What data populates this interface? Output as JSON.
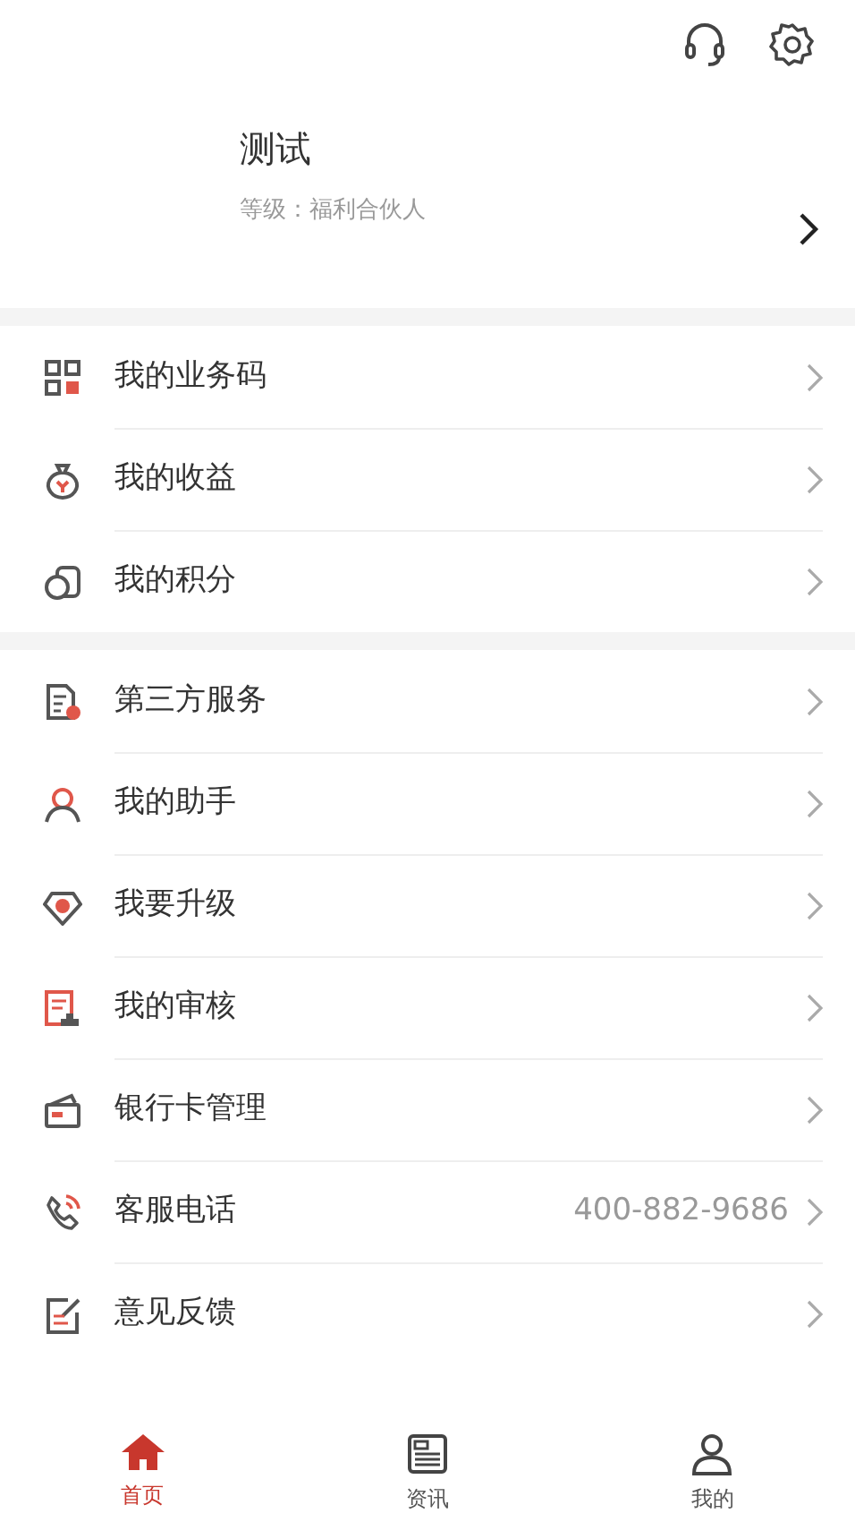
{
  "profile": {
    "name": "测试",
    "level": "等级：福利合伙人"
  },
  "menu_groups": [
    {
      "items": [
        {
          "label": "我的业务码"
        },
        {
          "label": "我的收益"
        },
        {
          "label": "我的积分"
        }
      ]
    },
    {
      "items": [
        {
          "label": "第三方服务"
        },
        {
          "label": "我的助手"
        },
        {
          "label": "我要升级"
        },
        {
          "label": "我的审核"
        },
        {
          "label": "银行卡管理"
        },
        {
          "label": "客服电话",
          "value": "400-882-9686"
        },
        {
          "label": "意见反馈"
        }
      ]
    }
  ],
  "tabs": [
    {
      "label": "首页",
      "selected": true
    },
    {
      "label": "资讯",
      "selected": false
    },
    {
      "label": "我的",
      "selected": false
    }
  ]
}
